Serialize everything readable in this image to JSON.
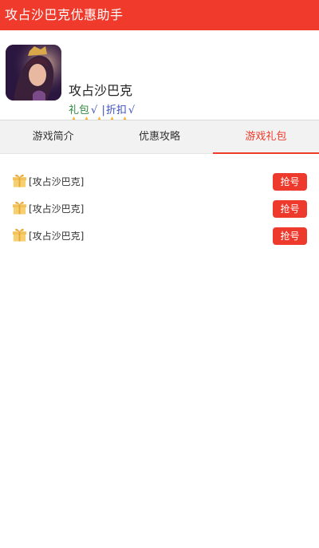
{
  "app": {
    "title": "攻占沙巴克优惠助手"
  },
  "game": {
    "name": "攻占沙巴克",
    "tags": {
      "gift_label": "礼包",
      "gift_check": "√",
      "separator": "|",
      "discount_label": "折扣",
      "discount_check": "√"
    },
    "rating": 5
  },
  "tabs": [
    {
      "label": "游戏简介",
      "active": false
    },
    {
      "label": "优惠攻略",
      "active": false
    },
    {
      "label": "游戏礼包",
      "active": true
    }
  ],
  "gifts": [
    {
      "title": "[攻占沙巴克]",
      "button": "抢号",
      "icon": "gift-box-icon"
    },
    {
      "title": "[攻占沙巴克]",
      "button": "抢号",
      "icon": "gift-box-icon"
    },
    {
      "title": "[攻占沙巴克]",
      "button": "抢号",
      "icon": "gift-box-icon"
    }
  ],
  "colors": {
    "brand_red": "#f03a2b",
    "star_gold": "#f6b01a",
    "gift_green": "#2e8b3e",
    "discount_blue": "#3b4fb8"
  }
}
